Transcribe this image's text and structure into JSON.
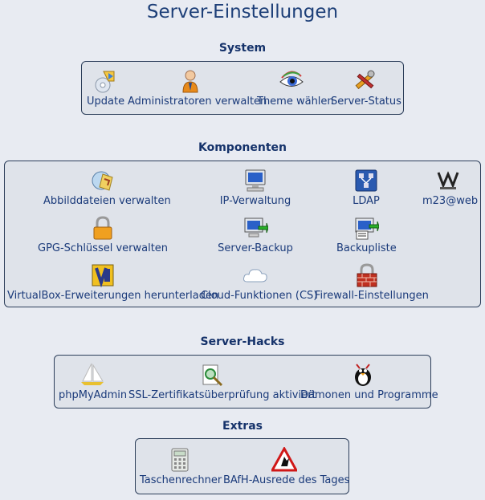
{
  "page": {
    "title": "Server-Einstellungen"
  },
  "sections": {
    "system": {
      "title": "System",
      "items": [
        {
          "label": "Update",
          "icon": "update-icon"
        },
        {
          "label": "Administratoren verwalten",
          "icon": "admin-user-icon"
        },
        {
          "label": "Theme wählen",
          "icon": "theme-eye-icon"
        },
        {
          "label": "Server-Status",
          "icon": "server-status-tools-icon"
        }
      ]
    },
    "components": {
      "title": "Komponenten",
      "items": [
        {
          "label": "Abbilddateien verwalten",
          "icon": "image-files-icon"
        },
        {
          "label": "IP-Verwaltung",
          "icon": "monitor-icon"
        },
        {
          "label": "LDAP",
          "icon": "ldap-icon"
        },
        {
          "label": "m23@web",
          "icon": "m23-logo-icon"
        },
        {
          "label": "GPG-Schlüssel verwalten",
          "icon": "padlock-icon"
        },
        {
          "label": "Server-Backup",
          "icon": "server-backup-icon"
        },
        {
          "label": "Backupliste",
          "icon": "backup-list-icon"
        },
        {
          "label": "VirtualBox-Erweiterungen herunterladen",
          "icon": "virtualbox-icon"
        },
        {
          "label": "Cloud-Funktionen (CS)",
          "icon": "cloud-icon"
        },
        {
          "label": "Firewall-Einstellungen",
          "icon": "firewall-icon"
        }
      ]
    },
    "hacks": {
      "title": "Server-Hacks",
      "items": [
        {
          "label": "phpMyAdmin",
          "icon": "phpmyadmin-sailboat-icon"
        },
        {
          "label": "SSL-Zertifikatsüberprüfung aktiviert",
          "icon": "ssl-certificate-icon"
        },
        {
          "label": "Dämonen und Programme",
          "icon": "daemon-tux-icon"
        }
      ]
    },
    "extras": {
      "title": "Extras",
      "items": [
        {
          "label": "Taschenrechner",
          "icon": "calculator-icon"
        },
        {
          "label": "BAfH-Ausrede des Tages",
          "icon": "warning-sign-icon"
        }
      ]
    }
  },
  "colors": {
    "title": "#1d3f78",
    "section_title": "#15326a",
    "link": "#1a3a7a",
    "box_bg": "#dfe3ea",
    "page_bg": "#e8ebf2"
  }
}
